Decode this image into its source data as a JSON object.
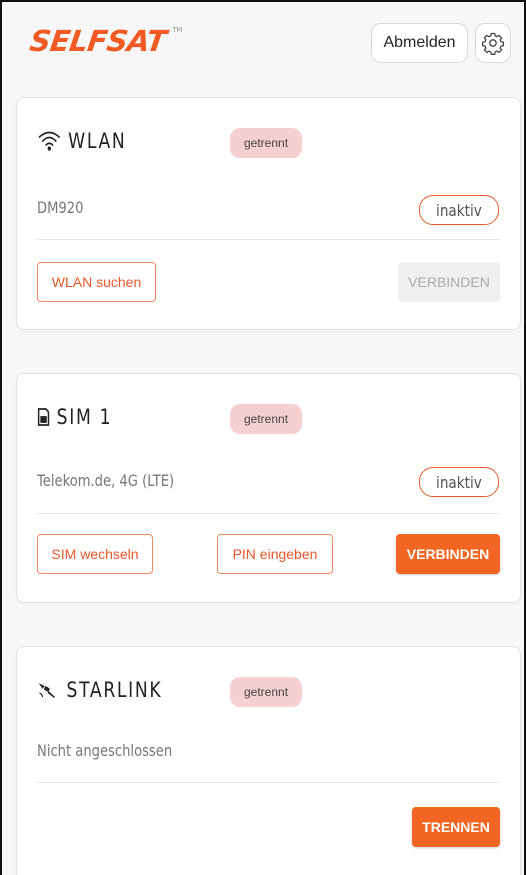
{
  "header": {
    "logo_text": "SELFSAT",
    "logo_tm": "TM",
    "logout_label": "Abmelden",
    "settings_icon": "gear-icon"
  },
  "wlan": {
    "icon": "wifi-icon",
    "title": "WLAN",
    "status": "getrennt",
    "network": "DM920",
    "state": "inaktiv",
    "search_label": "WLAN suchen",
    "connect_label": "VERBINDEN"
  },
  "sim": {
    "icon": "sim-card-icon",
    "title": "SIM 1",
    "status": "getrennt",
    "network": "Telekom.de, 4G (LTE)",
    "state": "inaktiv",
    "switch_label": "SIM wechseln",
    "pin_label": "PIN eingeben",
    "connect_label": "VERBINDEN"
  },
  "starlink": {
    "icon": "satellite-icon",
    "title": "STARLINK",
    "status": "getrennt",
    "info": "Nicht angeschlossen",
    "disconnect_label": "TRENNEN"
  },
  "colors": {
    "accent": "#f26522",
    "badge_bg": "#f6cfd0",
    "logo": "#f15a22"
  }
}
